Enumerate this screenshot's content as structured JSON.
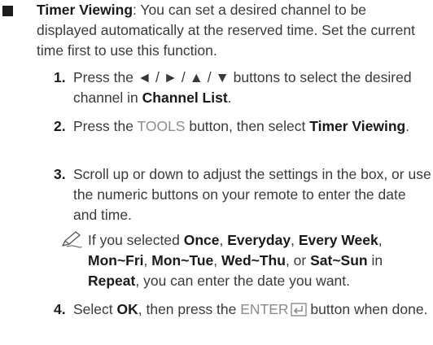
{
  "intro": {
    "title": "Timer Viewing",
    "text": ": You can set a desired channel to be displayed automatically at the reserved time. Set the current time first to use this function."
  },
  "steps": [
    {
      "num": "1.",
      "pre": "Press the ◄ / ► / ▲ / ▼ buttons to select the desired channel in ",
      "bold": "Channel List",
      "post": "."
    },
    {
      "num": "2.",
      "pre": "Press the ",
      "key": "TOOLS",
      "mid": " button, then select ",
      "bold": "Timer Viewing",
      "post": "."
    },
    {
      "num": "3.",
      "text": "Scroll up or down to adjust the settings in the box, or use the numeric buttons on your remote to enter the date and time."
    },
    {
      "num": "4.",
      "pre": "Select ",
      "bold": "OK",
      "mid": ", then press the ",
      "key": "ENTER",
      "post": " button when done."
    }
  ],
  "note": {
    "pre": "If you selected ",
    "opt1": "Once",
    "opt2": "Everyday",
    "opt3": "Every Week",
    "opt4": "Mon~Fri",
    "opt5": "Mon~Tue",
    "opt6": "Wed~Thu",
    "opt7": "Sat~Sun",
    "mid": " in ",
    "menu": "Repeat",
    "post": ", you can enter the date you want.",
    "sep_comma": ", ",
    "sep_or": ", or "
  },
  "icons": {
    "bullet": "square-bullet-icon",
    "note": "pencil-note-icon",
    "enter": "enter-key-icon"
  }
}
